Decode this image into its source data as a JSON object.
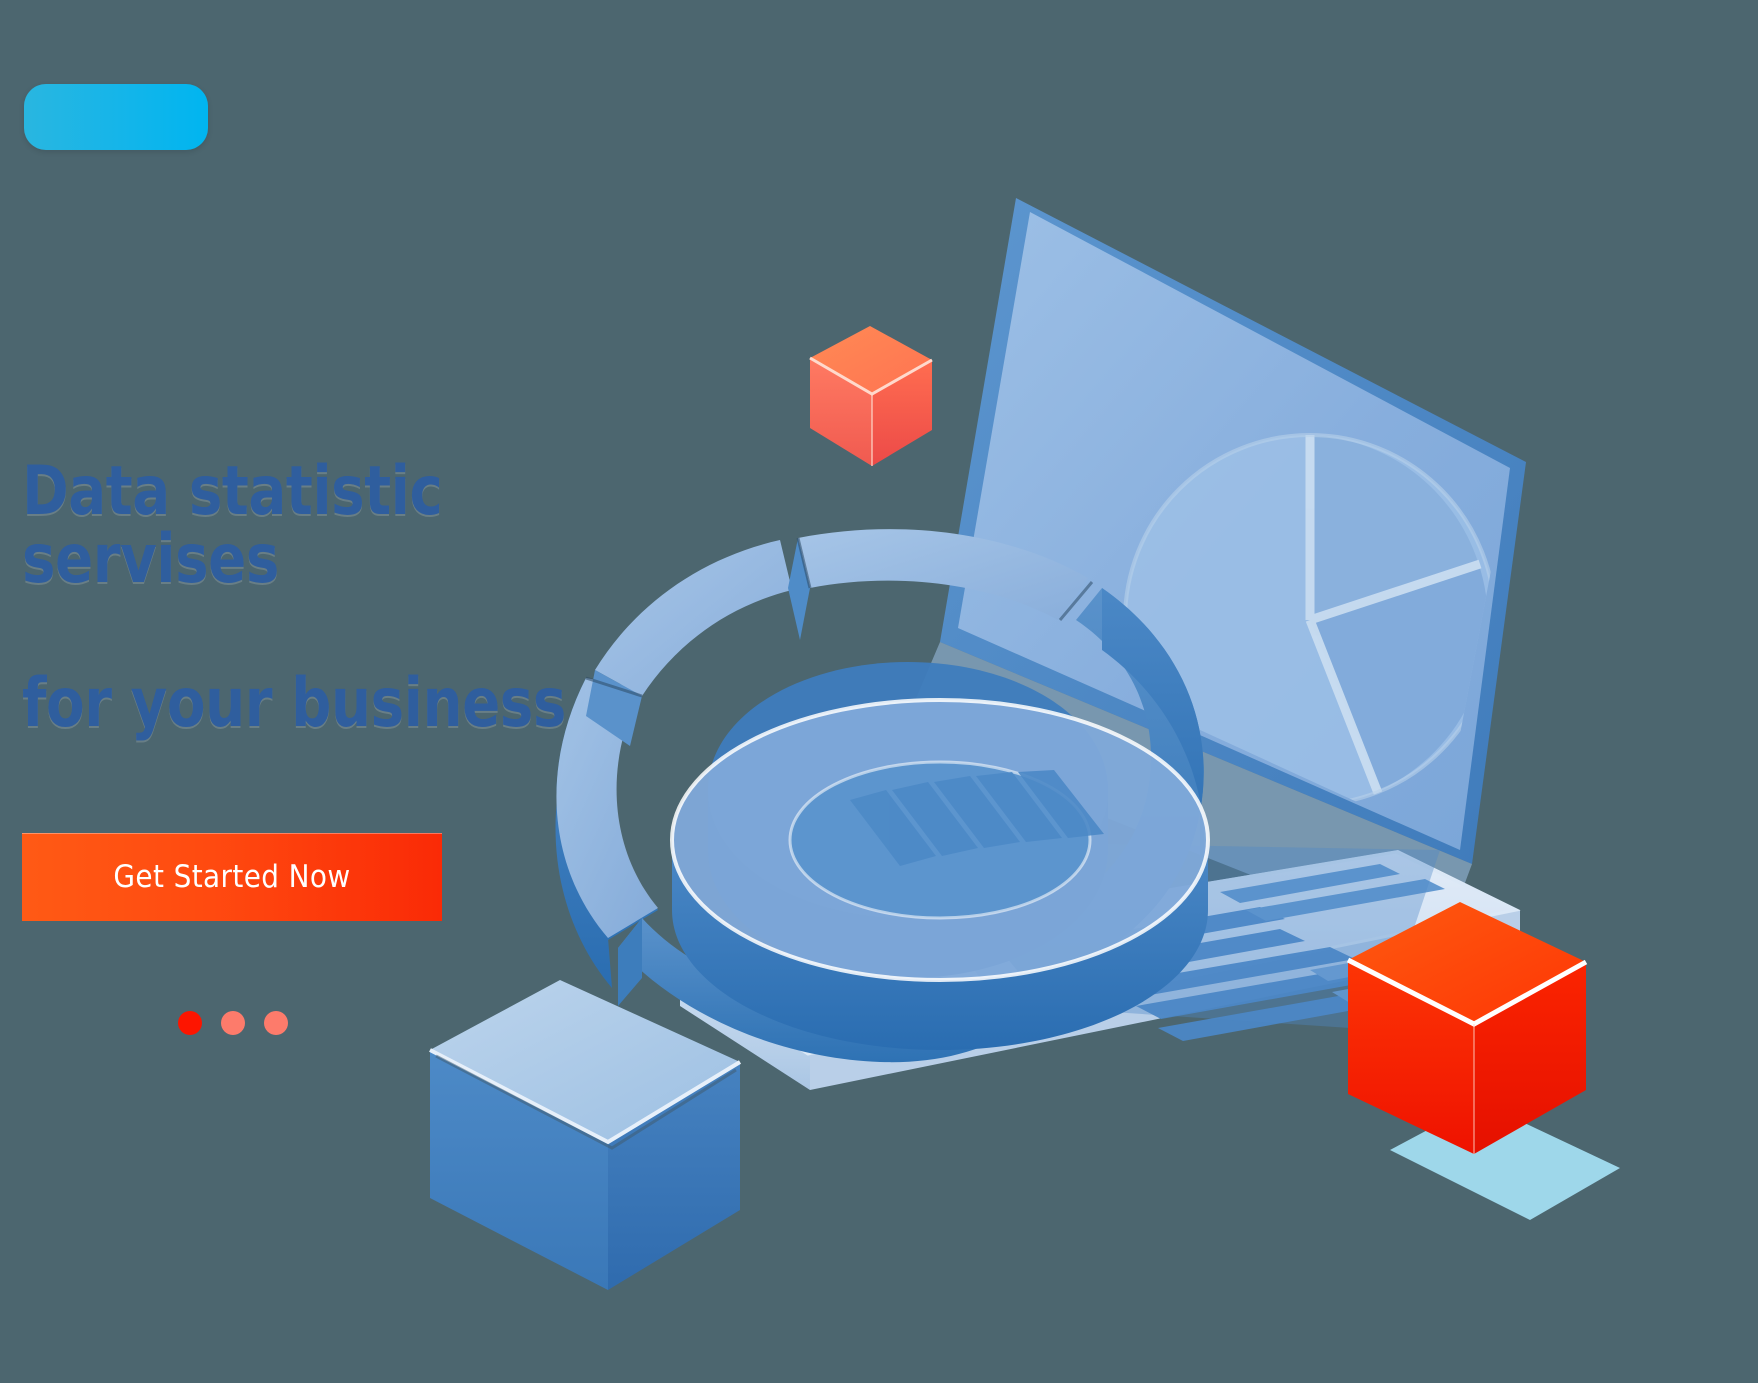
{
  "page": {
    "background_color": "#4c666f",
    "accent_blue": "#2f5e9e",
    "accent_orange": "#ff4a10",
    "accent_cyan": "#18b5e8"
  },
  "logo": {
    "name": "brand-pill",
    "gradient_from": "#29b6e0",
    "gradient_to": "#00b5f0"
  },
  "hero": {
    "headline_line1": "Data statistic servises",
    "headline_line2": "for your business",
    "headline_color": "#2f5e9e"
  },
  "cta": {
    "label": "Get Started Now",
    "gradient_from": "#ff5a15",
    "gradient_to": "#fa2a06",
    "text_color": "#ffffff"
  },
  "carousel": {
    "dots": [
      {
        "label": "slide-1",
        "active": true,
        "color": "#fd1500"
      },
      {
        "label": "slide-2",
        "active": false,
        "color": "#fd7b6b"
      },
      {
        "label": "slide-3",
        "active": false,
        "color": "#fd7b6b"
      }
    ]
  },
  "illustration": {
    "description": "Isometric laptop with 3D exploded donut chart, bar chart keyboard, and floating cubes",
    "elements": [
      {
        "name": "laptop-screen",
        "color": "#8fb4de"
      },
      {
        "name": "laptop-base",
        "color": "#cfe0f2"
      },
      {
        "name": "donut-chart-3d",
        "color": "#4a86c6"
      },
      {
        "name": "bar-chart",
        "color": "#5b93cd"
      },
      {
        "name": "cube-coral-small",
        "color": "#ff6a52"
      },
      {
        "name": "cube-red-large",
        "color": "#fc2b00"
      },
      {
        "name": "cube-blue-large",
        "color": "#4380c2"
      },
      {
        "name": "cube-shadow-cyan",
        "color": "#a7e3f7"
      }
    ]
  }
}
